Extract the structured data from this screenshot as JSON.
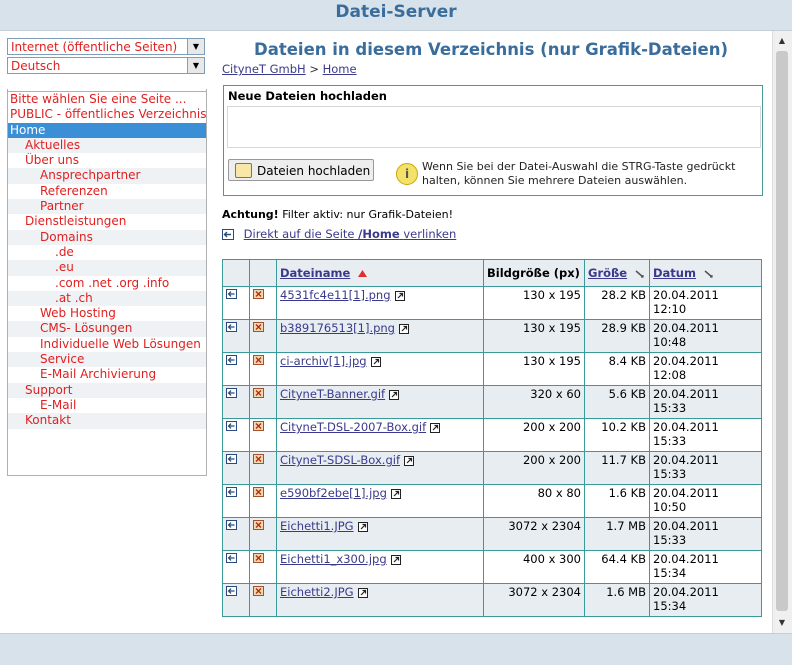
{
  "app": {
    "title": "Datei-Server"
  },
  "sidebar": {
    "select_site": "Internet (öffentliche Seiten)",
    "select_lang": "Deutsch",
    "items": [
      {
        "label": "Bitte wählen Sie eine Seite ...",
        "indent": 0
      },
      {
        "label": "PUBLIC - öffentliches Verzeichnis",
        "indent": 0
      },
      {
        "label": "Home",
        "indent": 0
      },
      {
        "label": "Aktuelles",
        "indent": 1
      },
      {
        "label": "Über uns",
        "indent": 1
      },
      {
        "label": "Ansprechpartner",
        "indent": 2
      },
      {
        "label": "Referenzen",
        "indent": 2
      },
      {
        "label": "Partner",
        "indent": 2
      },
      {
        "label": "Dienstleistungen",
        "indent": 1
      },
      {
        "label": "Domains",
        "indent": 2
      },
      {
        "label": ".de",
        "indent": 3
      },
      {
        "label": ".eu",
        "indent": 3
      },
      {
        "label": ".com .net .org .info",
        "indent": 3
      },
      {
        "label": ".at .ch",
        "indent": 3
      },
      {
        "label": "Web Hosting",
        "indent": 2
      },
      {
        "label": "CMS- Lösungen",
        "indent": 2
      },
      {
        "label": "Individuelle Web Lösungen",
        "indent": 2
      },
      {
        "label": "Service",
        "indent": 2
      },
      {
        "label": "E-Mail Archivierung",
        "indent": 2
      },
      {
        "label": "Support",
        "indent": 1
      },
      {
        "label": "E-Mail",
        "indent": 2
      },
      {
        "label": "Kontakt",
        "indent": 1
      }
    ]
  },
  "main": {
    "heading": "Dateien in diesem Verzeichnis (nur Grafik-Dateien)",
    "crumb_root": "CityneT GmbH",
    "crumb_sep": ">",
    "crumb_current": "Home",
    "upload": {
      "title": "Neue Dateien hochladen",
      "button": "Dateien hochladen",
      "info_glyph": "i",
      "info_text": "Wenn Sie bei der Datei-Auswahl die STRG-Taste gedrückt halten, können Sie mehrere Dateien auswählen."
    },
    "filter_bold": "Achtung!",
    "filter_text": "Filter aktiv: nur Grafik-Dateien!",
    "link_prefix": "Direkt auf die Seite",
    "link_page": "/Home",
    "link_suffix": "verlinken",
    "columns": {
      "name": "Dateiname",
      "size": "Bildgröße (px)",
      "bytes": "Größe",
      "date": "Datum"
    },
    "rows": [
      {
        "name": "4531fc4e11[1].png",
        "dims": "130 x 195",
        "size": "28.2 KB",
        "date": "20.04.2011",
        "time": "12:10"
      },
      {
        "name": "b389176513[1].png",
        "dims": "130 x 195",
        "size": "28.9 KB",
        "date": "20.04.2011",
        "time": "10:48"
      },
      {
        "name": "ci-archiv[1].jpg",
        "dims": "130 x 195",
        "size": "8.4 KB",
        "date": "20.04.2011",
        "time": "12:08"
      },
      {
        "name": "CityneT-Banner.gif",
        "dims": "320 x 60",
        "size": "5.6 KB",
        "date": "20.04.2011",
        "time": "15:33"
      },
      {
        "name": "CityneT-DSL-2007-Box.gif",
        "dims": "200 x 200",
        "size": "10.2 KB",
        "date": "20.04.2011",
        "time": "15:33"
      },
      {
        "name": "CityneT-SDSL-Box.gif",
        "dims": "200 x 200",
        "size": "11.7 KB",
        "date": "20.04.2011",
        "time": "15:33"
      },
      {
        "name": "e590bf2ebe[1].jpg",
        "dims": "80 x 80",
        "size": "1.6 KB",
        "date": "20.04.2011",
        "time": "10:50"
      },
      {
        "name": "Eichetti1.JPG",
        "dims": "3072 x 2304",
        "size": "1.7 MB",
        "date": "20.04.2011",
        "time": "15:33"
      },
      {
        "name": "Eichetti1_x300.jpg",
        "dims": "400 x 300",
        "size": "64.4 KB",
        "date": "20.04.2011",
        "time": "15:34"
      },
      {
        "name": "Eichetti2.JPG",
        "dims": "3072 x 2304",
        "size": "1.6 MB",
        "date": "20.04.2011",
        "time": "15:34"
      }
    ]
  },
  "colors": {
    "accent": "#3a6d9c",
    "link": "#3a3a8c",
    "nav_red": "#e02020",
    "selected": "#3a8fd6",
    "table_border": "#3a9a9a"
  }
}
